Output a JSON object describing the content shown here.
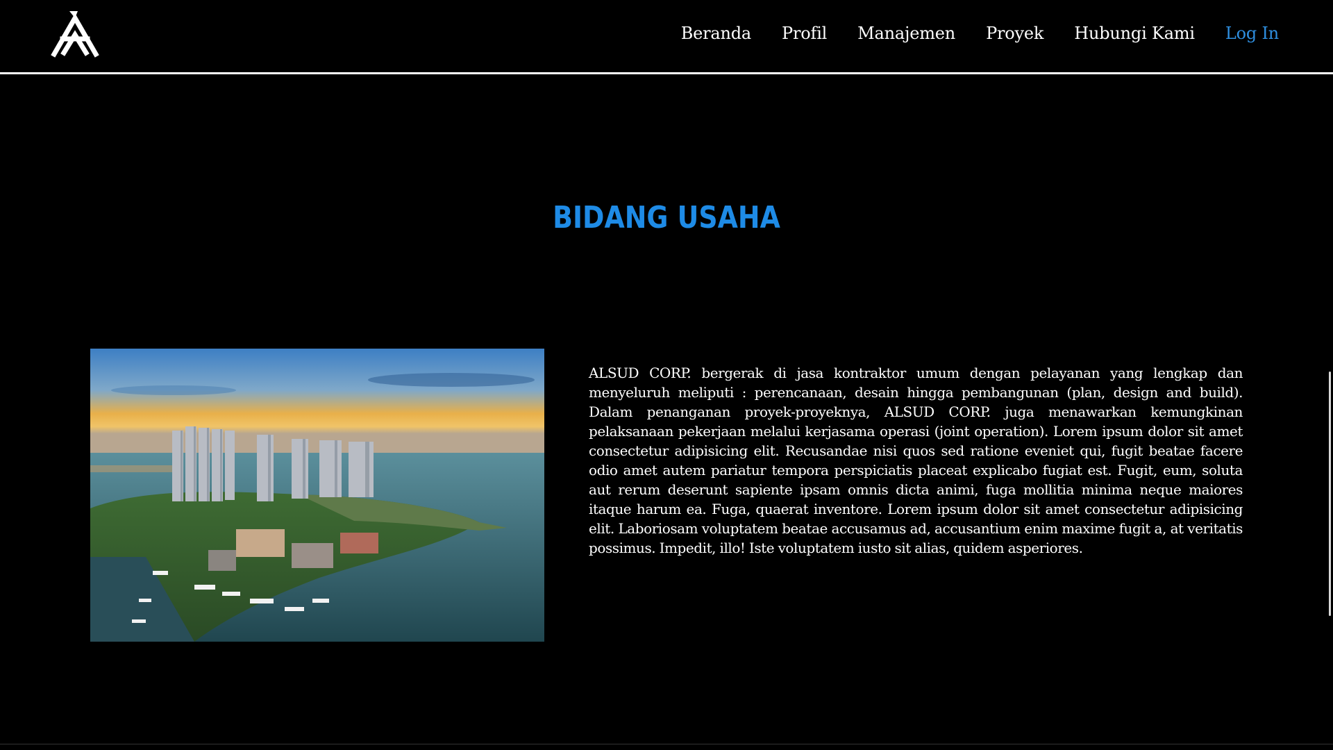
{
  "header": {
    "logo_icon": "company-monogram-logo",
    "nav": [
      {
        "label": "Beranda"
      },
      {
        "label": "Profil"
      },
      {
        "label": "Manajemen"
      },
      {
        "label": "Proyek"
      },
      {
        "label": "Hubungi Kami"
      },
      {
        "label": "Log In"
      }
    ]
  },
  "section": {
    "title": "BIDANG USAHA",
    "image_subject": "aerial photo of coastal high-rise towers and marina at sunset",
    "description": "ALSUD CORP. bergerak di jasa kontraktor umum dengan pelayanan yang lengkap dan menyeluruh meliputi : perencanaan, desain hingga pembangunan (plan, design and build). Dalam penanganan proyek-proyeknya, ALSUD CORP. juga menawarkan kemungkinan pelaksanaan pekerjaan melalui kerjasama operasi (joint operation). Lorem ipsum dolor sit amet consectetur adipisicing elit. Recusandae nisi quos sed ratione eveniet qui, fugit beatae facere odio amet autem pariatur tempora perspiciatis placeat explicabo fugiat est. Fugit, eum, soluta aut rerum deserunt sapiente ipsam omnis dicta animi, fuga mollitia minima neque maiores itaque harum ea. Fuga, quaerat inventore. Lorem ipsum dolor sit amet consectetur adipisicing elit. Laboriosam voluptatem beatae accusamus ad, accusantium enim maxime fugit a, at veritatis possimus. Impedit, illo! Iste voluptatem iusto sit alias, quidem asperiores."
  },
  "colors": {
    "background": "#000000",
    "accent": "#1e8be6",
    "login_link": "#2f8fe0",
    "text": "#ffffff"
  }
}
